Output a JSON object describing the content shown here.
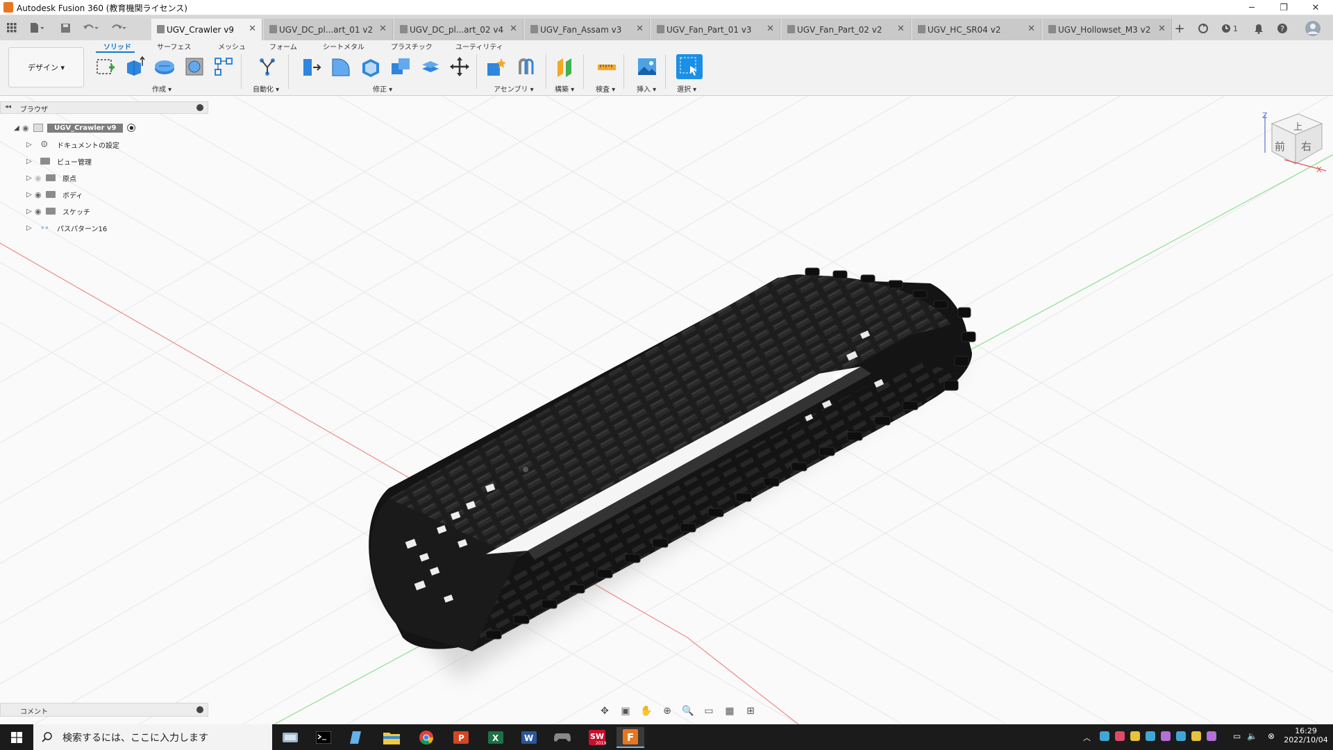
{
  "window": {
    "title": "Autodesk Fusion 360 (教育機関ライセンス)",
    "minimize": "─",
    "restore": "❐",
    "close": "✕"
  },
  "tabs": [
    {
      "label": "UGV_Crawler v9",
      "active": true
    },
    {
      "label": "UGV_DC_pl...art_01 v2"
    },
    {
      "label": "UGV_DC_pl...art_02 v4"
    },
    {
      "label": "UGV_Fan_Assam v3"
    },
    {
      "label": "UGV_Fan_Part_01 v3"
    },
    {
      "label": "UGV_Fan_Part_02 v2"
    },
    {
      "label": "UGV_HC_SR04 v2"
    },
    {
      "label": "UGV_Hollowset_M3 v2"
    }
  ],
  "tabbar_right": {
    "add": "+",
    "jobs_count": "1"
  },
  "ribbon": {
    "workspace": "デザイン ▾",
    "tabs": [
      "ソリッド",
      "サーフェス",
      "メッシュ",
      "フォーム",
      "シートメタル",
      "プラスチック",
      "ユーティリティ"
    ],
    "groups": [
      "作成 ▾",
      "自動化 ▾",
      "修正 ▾",
      "アセンブリ ▾",
      "構築 ▾",
      "検査 ▾",
      "挿入 ▾",
      "選択 ▾"
    ]
  },
  "browser": {
    "title": "ブラウザ",
    "root": "UGV_Crawler v9",
    "items": [
      "ドキュメントの設定",
      "ビュー管理",
      "原点",
      "ボディ",
      "スケッチ",
      "パスパターン16"
    ]
  },
  "viewcube": {
    "top": "上",
    "front": "前",
    "right": "右",
    "z": "Z",
    "x": "X"
  },
  "comments": {
    "title": "コメント"
  },
  "taskbar": {
    "search_placeholder": "検索するには、ここに入力します",
    "time": "16:29",
    "date": "2022/10/04",
    "sw_label": "2019"
  },
  "colors": {
    "accent": "#1177cc",
    "fusion_orange": "#e8761f",
    "model": "#1a1a1a",
    "x_axis": "#e05050",
    "y_axis": "#55cc55"
  }
}
